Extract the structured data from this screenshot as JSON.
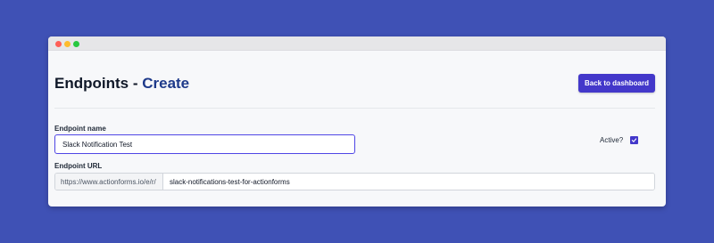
{
  "page": {
    "heading_prefix": "Endpoints - ",
    "heading_accent": "Create",
    "back_button": "Back to dashboard"
  },
  "form": {
    "endpoint_name_label": "Endpoint name",
    "endpoint_name_value": "Slack Notification Test",
    "active_label": "Active?",
    "active_checked": true,
    "endpoint_url_label": "Endpoint URL",
    "endpoint_url_prefix": "https://www.actionforms.io/e/r/",
    "endpoint_url_value": "slack-notifications-test-for-actionforms"
  },
  "colors": {
    "background": "#3f51b5",
    "accent": "#4338ca",
    "heading_accent": "#1e3a8a"
  }
}
